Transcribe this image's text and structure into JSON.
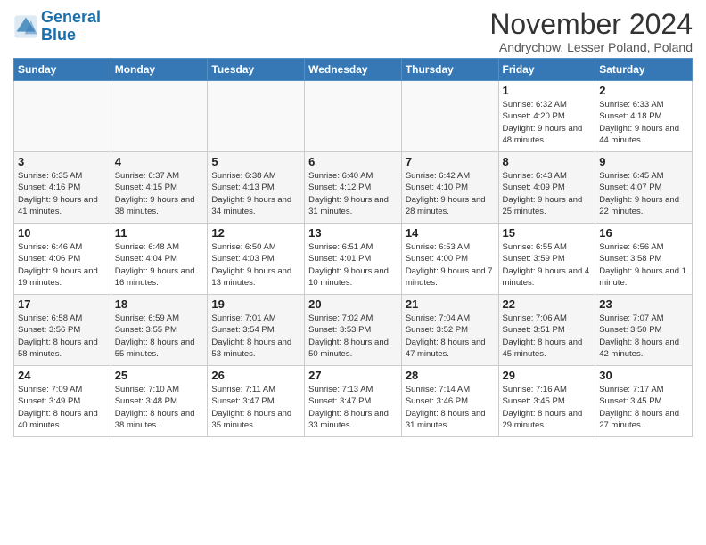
{
  "header": {
    "logo_general": "General",
    "logo_blue": "Blue",
    "month_title": "November 2024",
    "location": "Andrychow, Lesser Poland, Poland"
  },
  "columns": [
    "Sunday",
    "Monday",
    "Tuesday",
    "Wednesday",
    "Thursday",
    "Friday",
    "Saturday"
  ],
  "weeks": [
    {
      "days": [
        {
          "num": "",
          "info": ""
        },
        {
          "num": "",
          "info": ""
        },
        {
          "num": "",
          "info": ""
        },
        {
          "num": "",
          "info": ""
        },
        {
          "num": "",
          "info": ""
        },
        {
          "num": "1",
          "info": "Sunrise: 6:32 AM\nSunset: 4:20 PM\nDaylight: 9 hours and 48 minutes."
        },
        {
          "num": "2",
          "info": "Sunrise: 6:33 AM\nSunset: 4:18 PM\nDaylight: 9 hours and 44 minutes."
        }
      ]
    },
    {
      "days": [
        {
          "num": "3",
          "info": "Sunrise: 6:35 AM\nSunset: 4:16 PM\nDaylight: 9 hours and 41 minutes."
        },
        {
          "num": "4",
          "info": "Sunrise: 6:37 AM\nSunset: 4:15 PM\nDaylight: 9 hours and 38 minutes."
        },
        {
          "num": "5",
          "info": "Sunrise: 6:38 AM\nSunset: 4:13 PM\nDaylight: 9 hours and 34 minutes."
        },
        {
          "num": "6",
          "info": "Sunrise: 6:40 AM\nSunset: 4:12 PM\nDaylight: 9 hours and 31 minutes."
        },
        {
          "num": "7",
          "info": "Sunrise: 6:42 AM\nSunset: 4:10 PM\nDaylight: 9 hours and 28 minutes."
        },
        {
          "num": "8",
          "info": "Sunrise: 6:43 AM\nSunset: 4:09 PM\nDaylight: 9 hours and 25 minutes."
        },
        {
          "num": "9",
          "info": "Sunrise: 6:45 AM\nSunset: 4:07 PM\nDaylight: 9 hours and 22 minutes."
        }
      ]
    },
    {
      "days": [
        {
          "num": "10",
          "info": "Sunrise: 6:46 AM\nSunset: 4:06 PM\nDaylight: 9 hours and 19 minutes."
        },
        {
          "num": "11",
          "info": "Sunrise: 6:48 AM\nSunset: 4:04 PM\nDaylight: 9 hours and 16 minutes."
        },
        {
          "num": "12",
          "info": "Sunrise: 6:50 AM\nSunset: 4:03 PM\nDaylight: 9 hours and 13 minutes."
        },
        {
          "num": "13",
          "info": "Sunrise: 6:51 AM\nSunset: 4:01 PM\nDaylight: 9 hours and 10 minutes."
        },
        {
          "num": "14",
          "info": "Sunrise: 6:53 AM\nSunset: 4:00 PM\nDaylight: 9 hours and 7 minutes."
        },
        {
          "num": "15",
          "info": "Sunrise: 6:55 AM\nSunset: 3:59 PM\nDaylight: 9 hours and 4 minutes."
        },
        {
          "num": "16",
          "info": "Sunrise: 6:56 AM\nSunset: 3:58 PM\nDaylight: 9 hours and 1 minute."
        }
      ]
    },
    {
      "days": [
        {
          "num": "17",
          "info": "Sunrise: 6:58 AM\nSunset: 3:56 PM\nDaylight: 8 hours and 58 minutes."
        },
        {
          "num": "18",
          "info": "Sunrise: 6:59 AM\nSunset: 3:55 PM\nDaylight: 8 hours and 55 minutes."
        },
        {
          "num": "19",
          "info": "Sunrise: 7:01 AM\nSunset: 3:54 PM\nDaylight: 8 hours and 53 minutes."
        },
        {
          "num": "20",
          "info": "Sunrise: 7:02 AM\nSunset: 3:53 PM\nDaylight: 8 hours and 50 minutes."
        },
        {
          "num": "21",
          "info": "Sunrise: 7:04 AM\nSunset: 3:52 PM\nDaylight: 8 hours and 47 minutes."
        },
        {
          "num": "22",
          "info": "Sunrise: 7:06 AM\nSunset: 3:51 PM\nDaylight: 8 hours and 45 minutes."
        },
        {
          "num": "23",
          "info": "Sunrise: 7:07 AM\nSunset: 3:50 PM\nDaylight: 8 hours and 42 minutes."
        }
      ]
    },
    {
      "days": [
        {
          "num": "24",
          "info": "Sunrise: 7:09 AM\nSunset: 3:49 PM\nDaylight: 8 hours and 40 minutes."
        },
        {
          "num": "25",
          "info": "Sunrise: 7:10 AM\nSunset: 3:48 PM\nDaylight: 8 hours and 38 minutes."
        },
        {
          "num": "26",
          "info": "Sunrise: 7:11 AM\nSunset: 3:47 PM\nDaylight: 8 hours and 35 minutes."
        },
        {
          "num": "27",
          "info": "Sunrise: 7:13 AM\nSunset: 3:47 PM\nDaylight: 8 hours and 33 minutes."
        },
        {
          "num": "28",
          "info": "Sunrise: 7:14 AM\nSunset: 3:46 PM\nDaylight: 8 hours and 31 minutes."
        },
        {
          "num": "29",
          "info": "Sunrise: 7:16 AM\nSunset: 3:45 PM\nDaylight: 8 hours and 29 minutes."
        },
        {
          "num": "30",
          "info": "Sunrise: 7:17 AM\nSunset: 3:45 PM\nDaylight: 8 hours and 27 minutes."
        }
      ]
    }
  ]
}
